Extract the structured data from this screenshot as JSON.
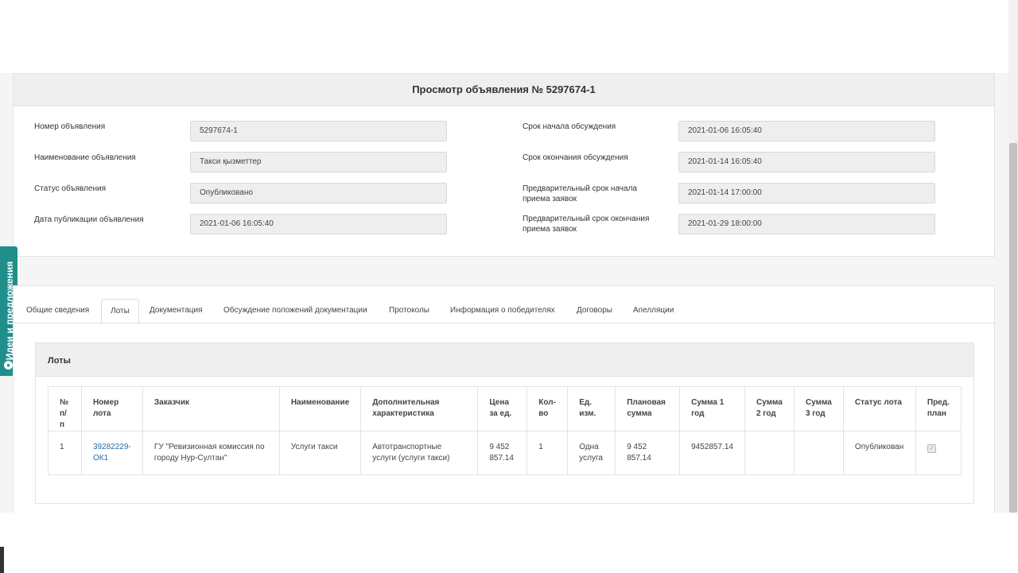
{
  "header": {
    "title": "Просмотр объявления № 5297674-1",
    "left_fields": [
      {
        "label": "Номер объявления",
        "value": "5297674-1"
      },
      {
        "label": "Наименование объявления",
        "value": "Такси қызметтер"
      },
      {
        "label": "Статус объявления",
        "value": "Опубликовано"
      },
      {
        "label": "Дата публикации объявления",
        "value": "2021-01-06 16:05:40"
      }
    ],
    "right_fields": [
      {
        "label": "Срок начала обсуждения",
        "value": "2021-01-06 16:05:40"
      },
      {
        "label": "Срок окончания обсуждения",
        "value": "2021-01-14 16:05:40"
      },
      {
        "label_1": "Предварительный срок начала",
        "label_2": "приема заявок",
        "value": "2021-01-14 17:00:00"
      },
      {
        "label_1": "Предварительный срок окончания",
        "label_2": "приема заявок",
        "value": "2021-01-29 18:00:00"
      }
    ]
  },
  "side_tab": {
    "label": "Идеи и предложения",
    "icon": "lightbulb-icon"
  },
  "tabs": [
    {
      "label": "Общие сведения"
    },
    {
      "label": "Лоты"
    },
    {
      "label": "Документация"
    },
    {
      "label": "Обсуждение положений документации"
    },
    {
      "label": "Протоколы"
    },
    {
      "label": "Информация о победителях"
    },
    {
      "label": "Договоры"
    },
    {
      "label": "Апелляции"
    }
  ],
  "active_tab": "Лоты",
  "lots": {
    "title": "Лоты",
    "columns": [
      [
        "№",
        "п/",
        "п"
      ],
      [
        "Номер",
        "лота"
      ],
      [
        "Заказчик"
      ],
      [
        "Наименование"
      ],
      [
        "Дополнительная",
        "характеристика"
      ],
      [
        "Цена",
        "за ед."
      ],
      [
        "Кол-",
        "во"
      ],
      [
        "Ед.",
        "изм."
      ],
      [
        "Плановая",
        "сумма"
      ],
      [
        "Сумма 1",
        "год"
      ],
      [
        "Сумма",
        "2 год"
      ],
      [
        "Сумма",
        "3 год"
      ],
      [
        "Статус лота"
      ],
      [
        "Пред.",
        "план"
      ]
    ],
    "rows": [
      {
        "num": "1",
        "lot_number_1": "39282229-",
        "lot_number_2": "ОК1",
        "customer_1": "ГУ \"Ревизионная комиссия по",
        "customer_2": "городу Нур-Султан\"",
        "name": "Услуги такси",
        "extra_1": "Автотранспортные",
        "extra_2": "услуги (услуги такси)",
        "price_1": "9 452",
        "price_2": "857.14",
        "qty": "1",
        "unit_1": "Одна",
        "unit_2": "услуга",
        "planned_1": "9 452",
        "planned_2": "857.14",
        "sum1": "9452857.14",
        "sum2": "",
        "sum3": "",
        "status": "Опубликован",
        "pre_plan_checked": true
      }
    ]
  },
  "colors": {
    "accent": "#1f8f8c",
    "link": "#2a6aa8"
  }
}
